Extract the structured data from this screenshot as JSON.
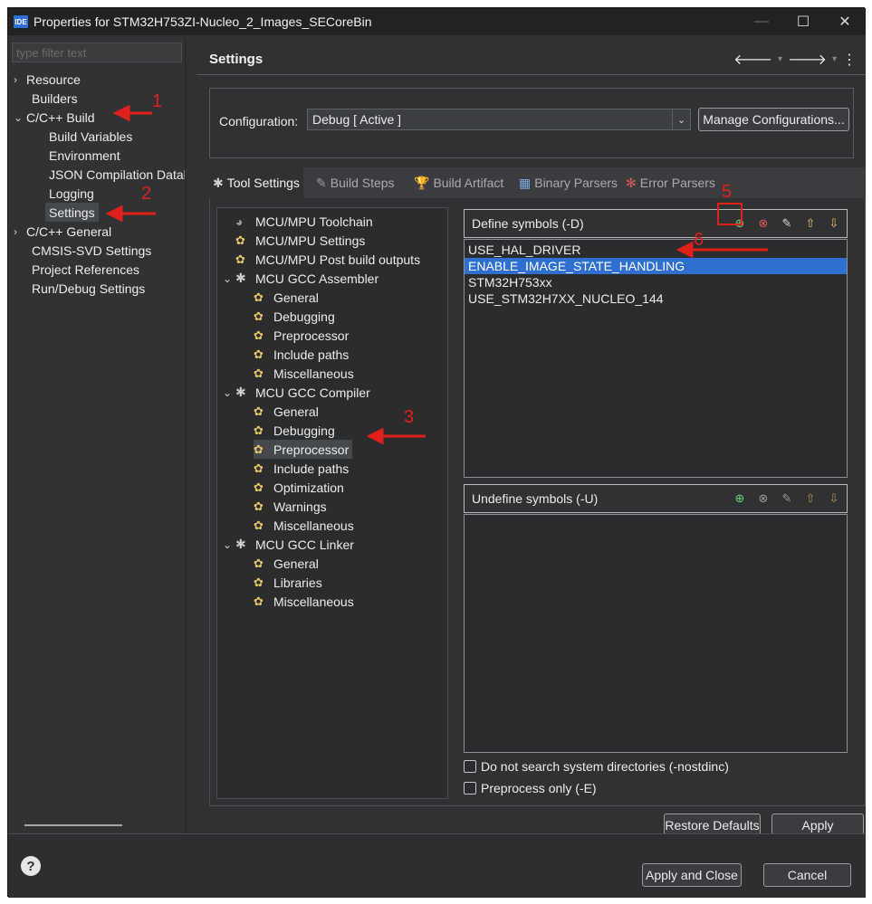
{
  "window": {
    "title": "Properties for STM32H753ZI-Nucleo_2_Images_SECoreBin",
    "app_badge": "IDE"
  },
  "filter": {
    "placeholder": "type filter text"
  },
  "nav": {
    "items": [
      {
        "label": "Resource"
      },
      {
        "label": "Builders"
      },
      {
        "label": "C/C++ Build"
      },
      {
        "label": "Build Variables"
      },
      {
        "label": "Environment"
      },
      {
        "label": "JSON Compilation Datab"
      },
      {
        "label": "Logging"
      },
      {
        "label": "Settings"
      },
      {
        "label": "C/C++ General"
      },
      {
        "label": "CMSIS-SVD Settings"
      },
      {
        "label": "Project References"
      },
      {
        "label": "Run/Debug Settings"
      }
    ]
  },
  "main": {
    "title": "Settings",
    "config_label": "Configuration:",
    "config_value": "Debug  [ Active ]",
    "manage_button": "Manage Configurations...",
    "tabs": [
      {
        "label": "Tool Settings"
      },
      {
        "label": "Build Steps"
      },
      {
        "label": "Build Artifact"
      },
      {
        "label": "Binary Parsers"
      },
      {
        "label": "Error Parsers"
      }
    ],
    "tree": [
      {
        "label": "MCU/MPU Toolchain"
      },
      {
        "label": "MCU/MPU Settings"
      },
      {
        "label": "MCU/MPU Post build outputs"
      },
      {
        "label": "MCU GCC Assembler"
      },
      {
        "label": "General"
      },
      {
        "label": "Debugging"
      },
      {
        "label": "Preprocessor"
      },
      {
        "label": "Include paths"
      },
      {
        "label": "Miscellaneous"
      },
      {
        "label": "MCU GCC Compiler"
      },
      {
        "label": "General"
      },
      {
        "label": "Debugging"
      },
      {
        "label": "Preprocessor"
      },
      {
        "label": "Include paths"
      },
      {
        "label": "Optimization"
      },
      {
        "label": "Warnings"
      },
      {
        "label": "Miscellaneous"
      },
      {
        "label": "MCU GCC Linker"
      },
      {
        "label": "General"
      },
      {
        "label": "Libraries"
      },
      {
        "label": "Miscellaneous"
      }
    ],
    "define_header": "Define symbols (-D)",
    "define_symbols": [
      "USE_HAL_DRIVER",
      "ENABLE_IMAGE_STATE_HANDLING",
      "STM32H753xx",
      "USE_STM32H7XX_NUCLEO_144"
    ],
    "undefine_header": "Undefine symbols (-U)",
    "nostdinc_label": "Do not search system directories (-nostdinc)",
    "preprocess_only_label": "Preprocess only (-E)",
    "restore_defaults": "Restore Defaults",
    "apply": "Apply"
  },
  "footer": {
    "apply_close": "Apply and Close",
    "cancel": "Cancel",
    "help": "?"
  },
  "annotations": {
    "a1": "1",
    "a2": "2",
    "a3": "3",
    "a5": "5",
    "a6": "6"
  },
  "colors": {
    "selection": "#2f6fd0",
    "annotation": "#e0201a",
    "background": "#2f3133"
  }
}
